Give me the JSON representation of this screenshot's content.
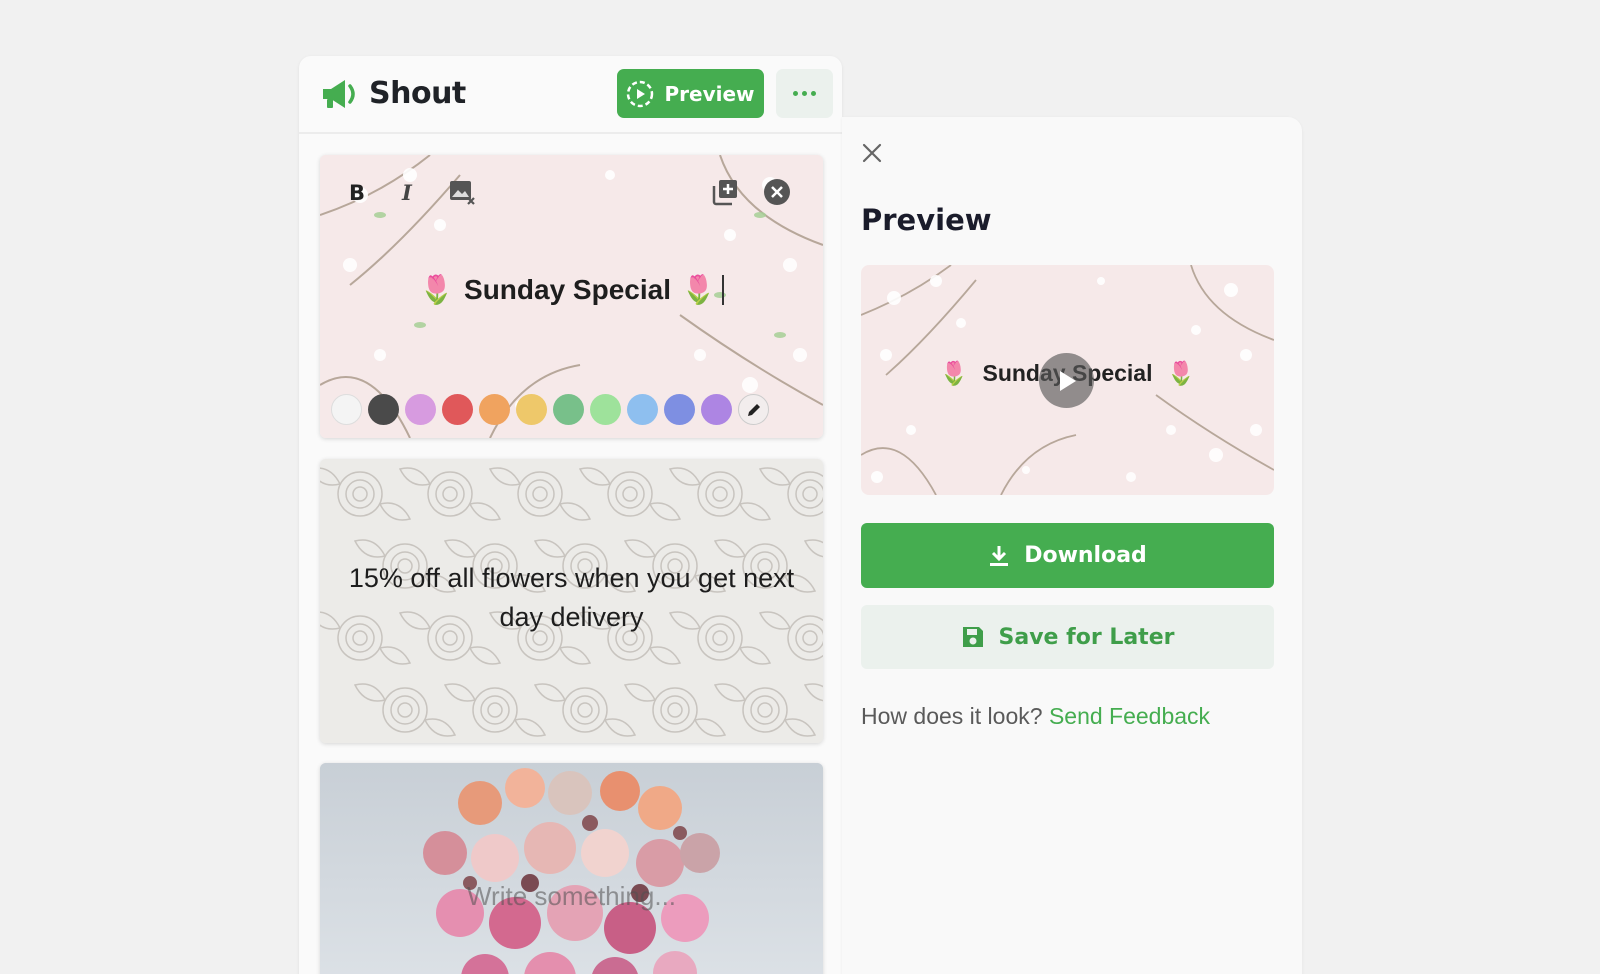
{
  "app": {
    "name": "Shout"
  },
  "header": {
    "preview_label": "Preview"
  },
  "cards": [
    {
      "title": "Sunday Special"
    },
    {
      "text": "15% off all flowers when you get next day delivery"
    },
    {
      "placeholder": "Write something..."
    }
  ],
  "swatches": [
    "#f4f4f4",
    "#4a4a4a",
    "#d79be0",
    "#e0585a",
    "#f0a35f",
    "#eec86a",
    "#78c08a",
    "#9ee29b",
    "#8ebfef",
    "#7e8fe2",
    "#ad85e3"
  ],
  "preview": {
    "title": "Preview",
    "caption": "Sunday Special",
    "download_label": "Download",
    "save_label": "Save for Later",
    "feedback_question": "How does it look?",
    "feedback_link": "Send Feedback"
  },
  "colors": {
    "accent": "#45ad50",
    "accent_light": "#ebf1ed"
  }
}
